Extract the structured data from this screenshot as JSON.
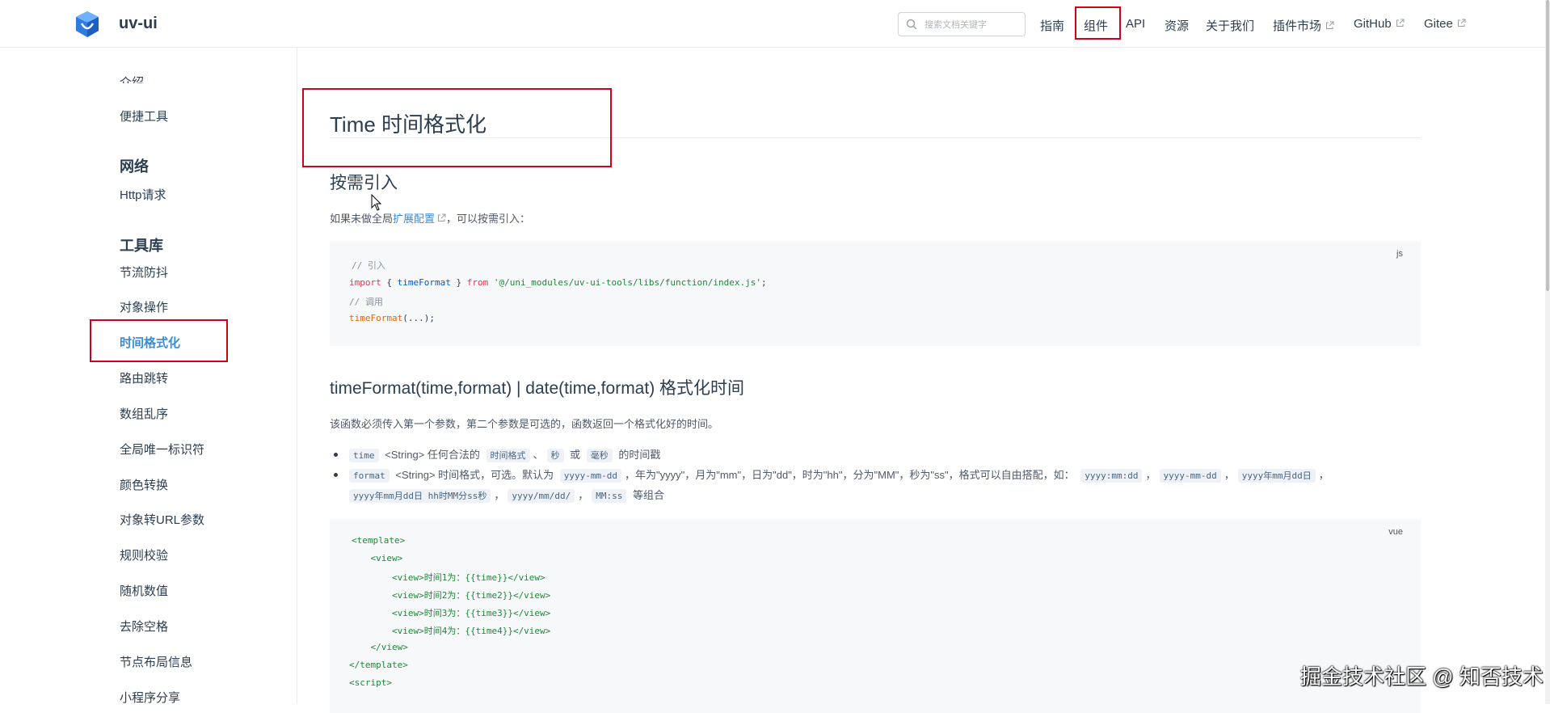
{
  "header": {
    "site_name": "uv-ui",
    "search_placeholder": "搜索文档关键字",
    "nav": [
      "指南",
      "组件",
      "API",
      "资源",
      "关于我们",
      "插件市场",
      "GitHub",
      "Gitee"
    ]
  },
  "sidebar": {
    "items": [
      {
        "label": "介绍",
        "type": "item"
      },
      {
        "label": "便捷工具",
        "type": "item"
      },
      {
        "label": "网络",
        "type": "heading"
      },
      {
        "label": "Http请求",
        "type": "item"
      },
      {
        "label": "工具库",
        "type": "heading"
      },
      {
        "label": "节流防抖",
        "type": "item"
      },
      {
        "label": "对象操作",
        "type": "item"
      },
      {
        "label": "时间格式化",
        "type": "item",
        "active": true
      },
      {
        "label": "路由跳转",
        "type": "item"
      },
      {
        "label": "数组乱序",
        "type": "item"
      },
      {
        "label": "全局唯一标识符",
        "type": "item"
      },
      {
        "label": "颜色转换",
        "type": "item"
      },
      {
        "label": "对象转URL参数",
        "type": "item"
      },
      {
        "label": "规则校验",
        "type": "item"
      },
      {
        "label": "随机数值",
        "type": "item"
      },
      {
        "label": "去除空格",
        "type": "item"
      },
      {
        "label": "节点布局信息",
        "type": "item"
      },
      {
        "label": "小程序分享",
        "type": "item"
      }
    ]
  },
  "main": {
    "title": "Time 时间格式化",
    "section1": {
      "heading": "按需引入",
      "text_before": "如果未做全局",
      "link": "扩展配置",
      "text_after": "，可以按需引入："
    },
    "code1": {
      "lang": "js",
      "comment1": "// 引入",
      "import_kw": "import",
      "import_name": "timeFormat",
      "from_kw": "from",
      "path": "'@/uni_modules/uv-ui-tools/libs/function/index.js'",
      "comment2": "// 调用",
      "call": "timeFormat",
      "call_args": "(...);"
    },
    "section2": {
      "heading": "timeFormat(time,format) | date(time,format) 格式化时间",
      "desc": "该函数必须传入第一个参数，第二个参数是可选的，函数返回一个格式化好的时间。",
      "b1_code": "time",
      "b1_text1": "<String> 任何合法的",
      "b1_code2": "时间格式",
      "b1_sep": "、",
      "b1_code3": "秒",
      "b1_or": "或",
      "b1_code4": "毫秒",
      "b1_text2": "的时间戳",
      "b2_code": "format",
      "b2_text1": "<String> 时间格式，可选。默认为",
      "b2_code2": "yyyy-mm-dd",
      "b2_text2": "，年为\"yyyy\"，月为\"mm\"，日为\"dd\"，时为\"hh\"，分为\"MM\"，秒为\"ss\"，格式可以自由搭配，如：",
      "b2_code3": "yyyy:mm:dd",
      "b2_code4": "yyyy-mm-dd",
      "b2_code5": "yyyy年mm月dd日",
      "b2_code6": "yyyy年mm月dd日 hh时MM分ss秒",
      "b2_code7": "yyyy/mm/dd/",
      "b2_code8": "MM:ss",
      "b2_text3": "等组合",
      "comma": "，"
    },
    "code2": {
      "lang": "vue",
      "lines": [
        "<template>",
        "    <view>",
        "        <view>时间1为：{{time}}</view>",
        "        <view>时间2为：{{time2}}</view>",
        "        <view>时间3为：{{time3}}</view>",
        "        <view>时间4为：{{time4}}</view>",
        "    </view>",
        "</template>",
        "<script>"
      ]
    }
  },
  "watermark": "掘金技术社区 @ 知否技术",
  "colors": {
    "accent": "#3a8bd9",
    "highlight_box": "#d0021b",
    "code_bg": "#f6f8fa"
  }
}
